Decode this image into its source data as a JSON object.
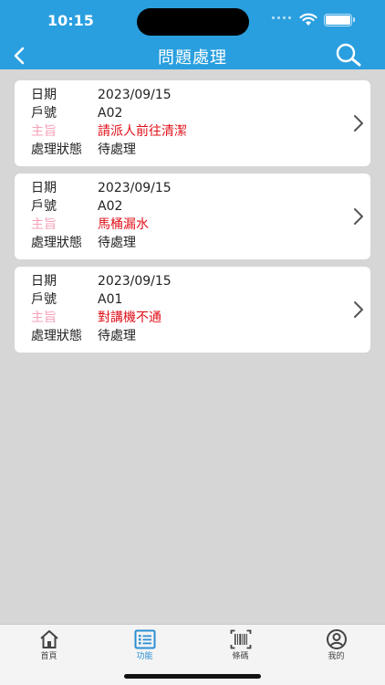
{
  "status_bar": {
    "time": "10:15"
  },
  "nav": {
    "title": "問題處理"
  },
  "cards": [
    {
      "date_label": "日期",
      "date": "2023/09/15",
      "unit_label": "戶號",
      "unit": "A02",
      "subject_label": "主旨",
      "subject": "請派人前往清潔",
      "status_label": "處理狀態",
      "status": "待處理"
    },
    {
      "date_label": "日期",
      "date": "2023/09/15",
      "unit_label": "戶號",
      "unit": "A02",
      "subject_label": "主旨",
      "subject": "馬桶漏水",
      "status_label": "處理狀態",
      "status": "待處理"
    },
    {
      "date_label": "日期",
      "date": "2023/09/15",
      "unit_label": "戶號",
      "unit": "A01",
      "subject_label": "主旨",
      "subject": "對講機不通",
      "status_label": "處理狀態",
      "status": "待處理"
    }
  ],
  "tabbar": {
    "tabs": [
      {
        "label": "首頁",
        "icon": "home-icon",
        "active": false
      },
      {
        "label": "功能",
        "icon": "list-icon",
        "active": true
      },
      {
        "label": "條碼",
        "icon": "barcode-icon",
        "active": false
      },
      {
        "label": "我的",
        "icon": "profile-icon",
        "active": false
      }
    ]
  },
  "colors": {
    "header": "#2a9fdf",
    "background": "#d6d6d6",
    "subject_label": "#f7a0b8",
    "subject_value": "#e0101a",
    "tab_active": "#2a8fd4"
  }
}
